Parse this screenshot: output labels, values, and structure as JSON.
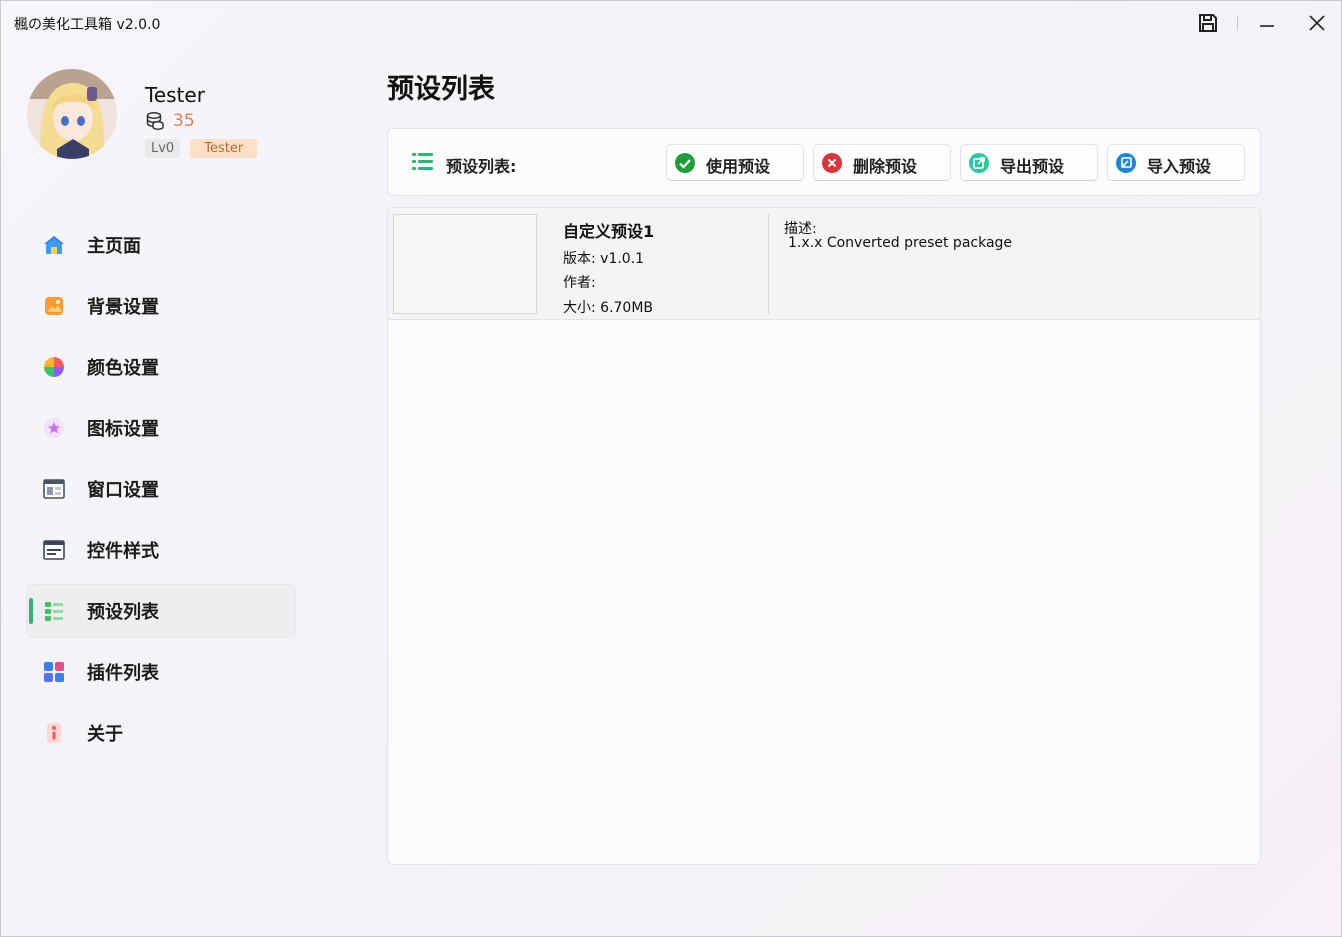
{
  "window": {
    "title": "楓の美化工具箱 v2.0.0"
  },
  "profile": {
    "username": "Tester",
    "coins": "35",
    "level": "Lv0",
    "role": "Tester"
  },
  "sidebar": {
    "items": [
      {
        "label": "主页面",
        "icon": "home-icon"
      },
      {
        "label": "背景设置",
        "icon": "image-icon"
      },
      {
        "label": "颜色设置",
        "icon": "palette-icon"
      },
      {
        "label": "图标设置",
        "icon": "star-icon"
      },
      {
        "label": "窗口设置",
        "icon": "window-icon"
      },
      {
        "label": "控件样式",
        "icon": "controls-icon"
      },
      {
        "label": "预设列表",
        "icon": "preset-list-icon",
        "active": true
      },
      {
        "label": "插件列表",
        "icon": "plugin-icon"
      },
      {
        "label": "关于",
        "icon": "info-icon"
      }
    ]
  },
  "main": {
    "title": "预设列表",
    "toolbar": {
      "label": "预设列表:",
      "use_label": "使用预设",
      "delete_label": "删除预设",
      "export_label": "导出预设",
      "import_label": "导入预设"
    },
    "presets": [
      {
        "name": "自定义预设1",
        "version": "版本: v1.0.1",
        "author": "作者:",
        "size": "大小: 6.70MB",
        "desc_header": "描述:",
        "description": "1.x.x Converted preset package"
      }
    ]
  },
  "colors": {
    "accent": "#2bb673",
    "coin": "#e07b57",
    "role_badge_bg": "#fbe0c6"
  }
}
